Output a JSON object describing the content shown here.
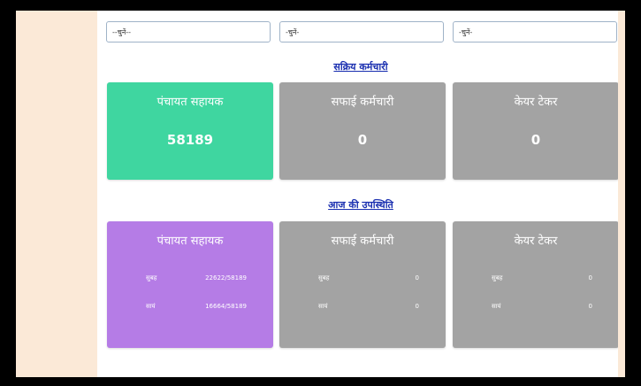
{
  "filters": [
    {
      "value": "--चुनें--"
    },
    {
      "value": "-चुनें-"
    },
    {
      "value": "-चुनें-"
    }
  ],
  "sections": {
    "active_staff": {
      "title": "सक्रिय कर्मचारी",
      "cards": [
        {
          "title": "पंचायत सहायक",
          "value": "58189"
        },
        {
          "title": "सफाई कर्मचारी",
          "value": "0"
        },
        {
          "title": "केयर टेकर",
          "value": "0"
        }
      ]
    },
    "attendance": {
      "title": "आज की उपस्थिति",
      "cards": [
        {
          "title": "पंचायत सहायक",
          "morning_label": "सुबह",
          "morning_value": "22622/58189",
          "evening_label": "सायं",
          "evening_value": "16664/58189"
        },
        {
          "title": "सफाई कर्मचारी",
          "morning_label": "सुबह",
          "morning_value": "0",
          "evening_label": "सायं",
          "evening_value": "0"
        },
        {
          "title": "केयर टेकर",
          "morning_label": "सुबह",
          "morning_value": "0",
          "evening_label": "सायं",
          "evening_value": "0"
        }
      ]
    }
  },
  "colors": {
    "green": "#3fd6a0",
    "gray": "#a3a3a3",
    "purple": "#b57ce6",
    "link": "#1a2fb0",
    "sidebar": "#fbe9d7"
  }
}
